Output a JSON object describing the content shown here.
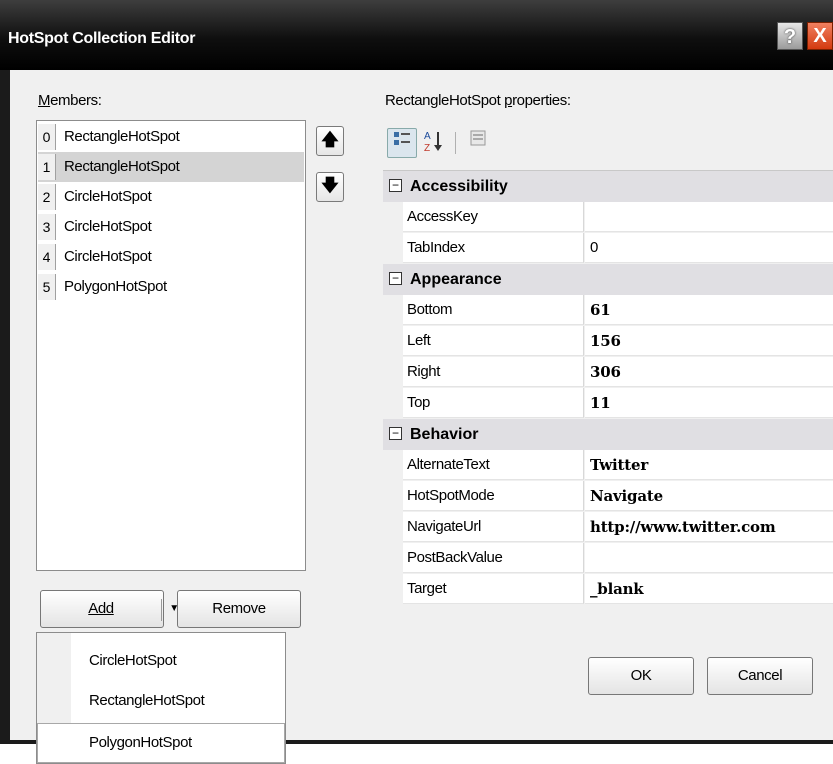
{
  "window": {
    "title": "HotSpot Collection Editor",
    "help_glyph": "?",
    "close_glyph": "X"
  },
  "members": {
    "label": "Members:",
    "items": [
      {
        "index": "0",
        "name": "RectangleHotSpot",
        "selected": false
      },
      {
        "index": "1",
        "name": "RectangleHotSpot",
        "selected": true
      },
      {
        "index": "2",
        "name": "CircleHotSpot",
        "selected": false
      },
      {
        "index": "3",
        "name": "CircleHotSpot",
        "selected": false
      },
      {
        "index": "4",
        "name": "CircleHotSpot",
        "selected": false
      },
      {
        "index": "5",
        "name": "PolygonHotSpot",
        "selected": false
      }
    ],
    "move_up_glyph": "🡅",
    "move_down_glyph": "🡇"
  },
  "buttons": {
    "add": "Add",
    "add_caret": "▼",
    "remove": "Remove",
    "ok": "OK",
    "cancel": "Cancel"
  },
  "add_dropdown": {
    "items": [
      "CircleHotSpot",
      "RectangleHotSpot",
      "PolygonHotSpot"
    ],
    "highlighted": "PolygonHotSpot"
  },
  "properties": {
    "label": "RectangleHotSpot properties:",
    "toolbar": {
      "categorized_icon": "categorized-icon",
      "alphabetical_icon": "alphabetical-icon",
      "property_pages_icon": "property-pages-icon"
    },
    "categories": [
      {
        "name": "Accessibility",
        "toggle": "⊟",
        "props": [
          {
            "name": "AccessKey",
            "value": "",
            "bold": false
          },
          {
            "name": "TabIndex",
            "value": "0",
            "bold": false
          }
        ]
      },
      {
        "name": "Appearance",
        "toggle": "⊟",
        "props": [
          {
            "name": "Bottom",
            "value": "61",
            "bold": true
          },
          {
            "name": "Left",
            "value": "156",
            "bold": true
          },
          {
            "name": "Right",
            "value": "306",
            "bold": true
          },
          {
            "name": "Top",
            "value": "11",
            "bold": true
          }
        ]
      },
      {
        "name": "Behavior",
        "toggle": "⊟",
        "props": [
          {
            "name": "AlternateText",
            "value": "Twitter",
            "bold": true
          },
          {
            "name": "HotSpotMode",
            "value": "Navigate",
            "bold": true
          },
          {
            "name": "NavigateUrl",
            "value": "http://www.twitter.com",
            "bold": true
          },
          {
            "name": "PostBackValue",
            "value": "",
            "bold": false
          },
          {
            "name": "Target",
            "value": "_blank",
            "bold": true
          }
        ]
      }
    ]
  },
  "colors": {
    "titlebar": "#0f0f0f",
    "selection": "#d4d4d4",
    "category_row": "#e0dfe3",
    "close_button": "#d33a10"
  }
}
